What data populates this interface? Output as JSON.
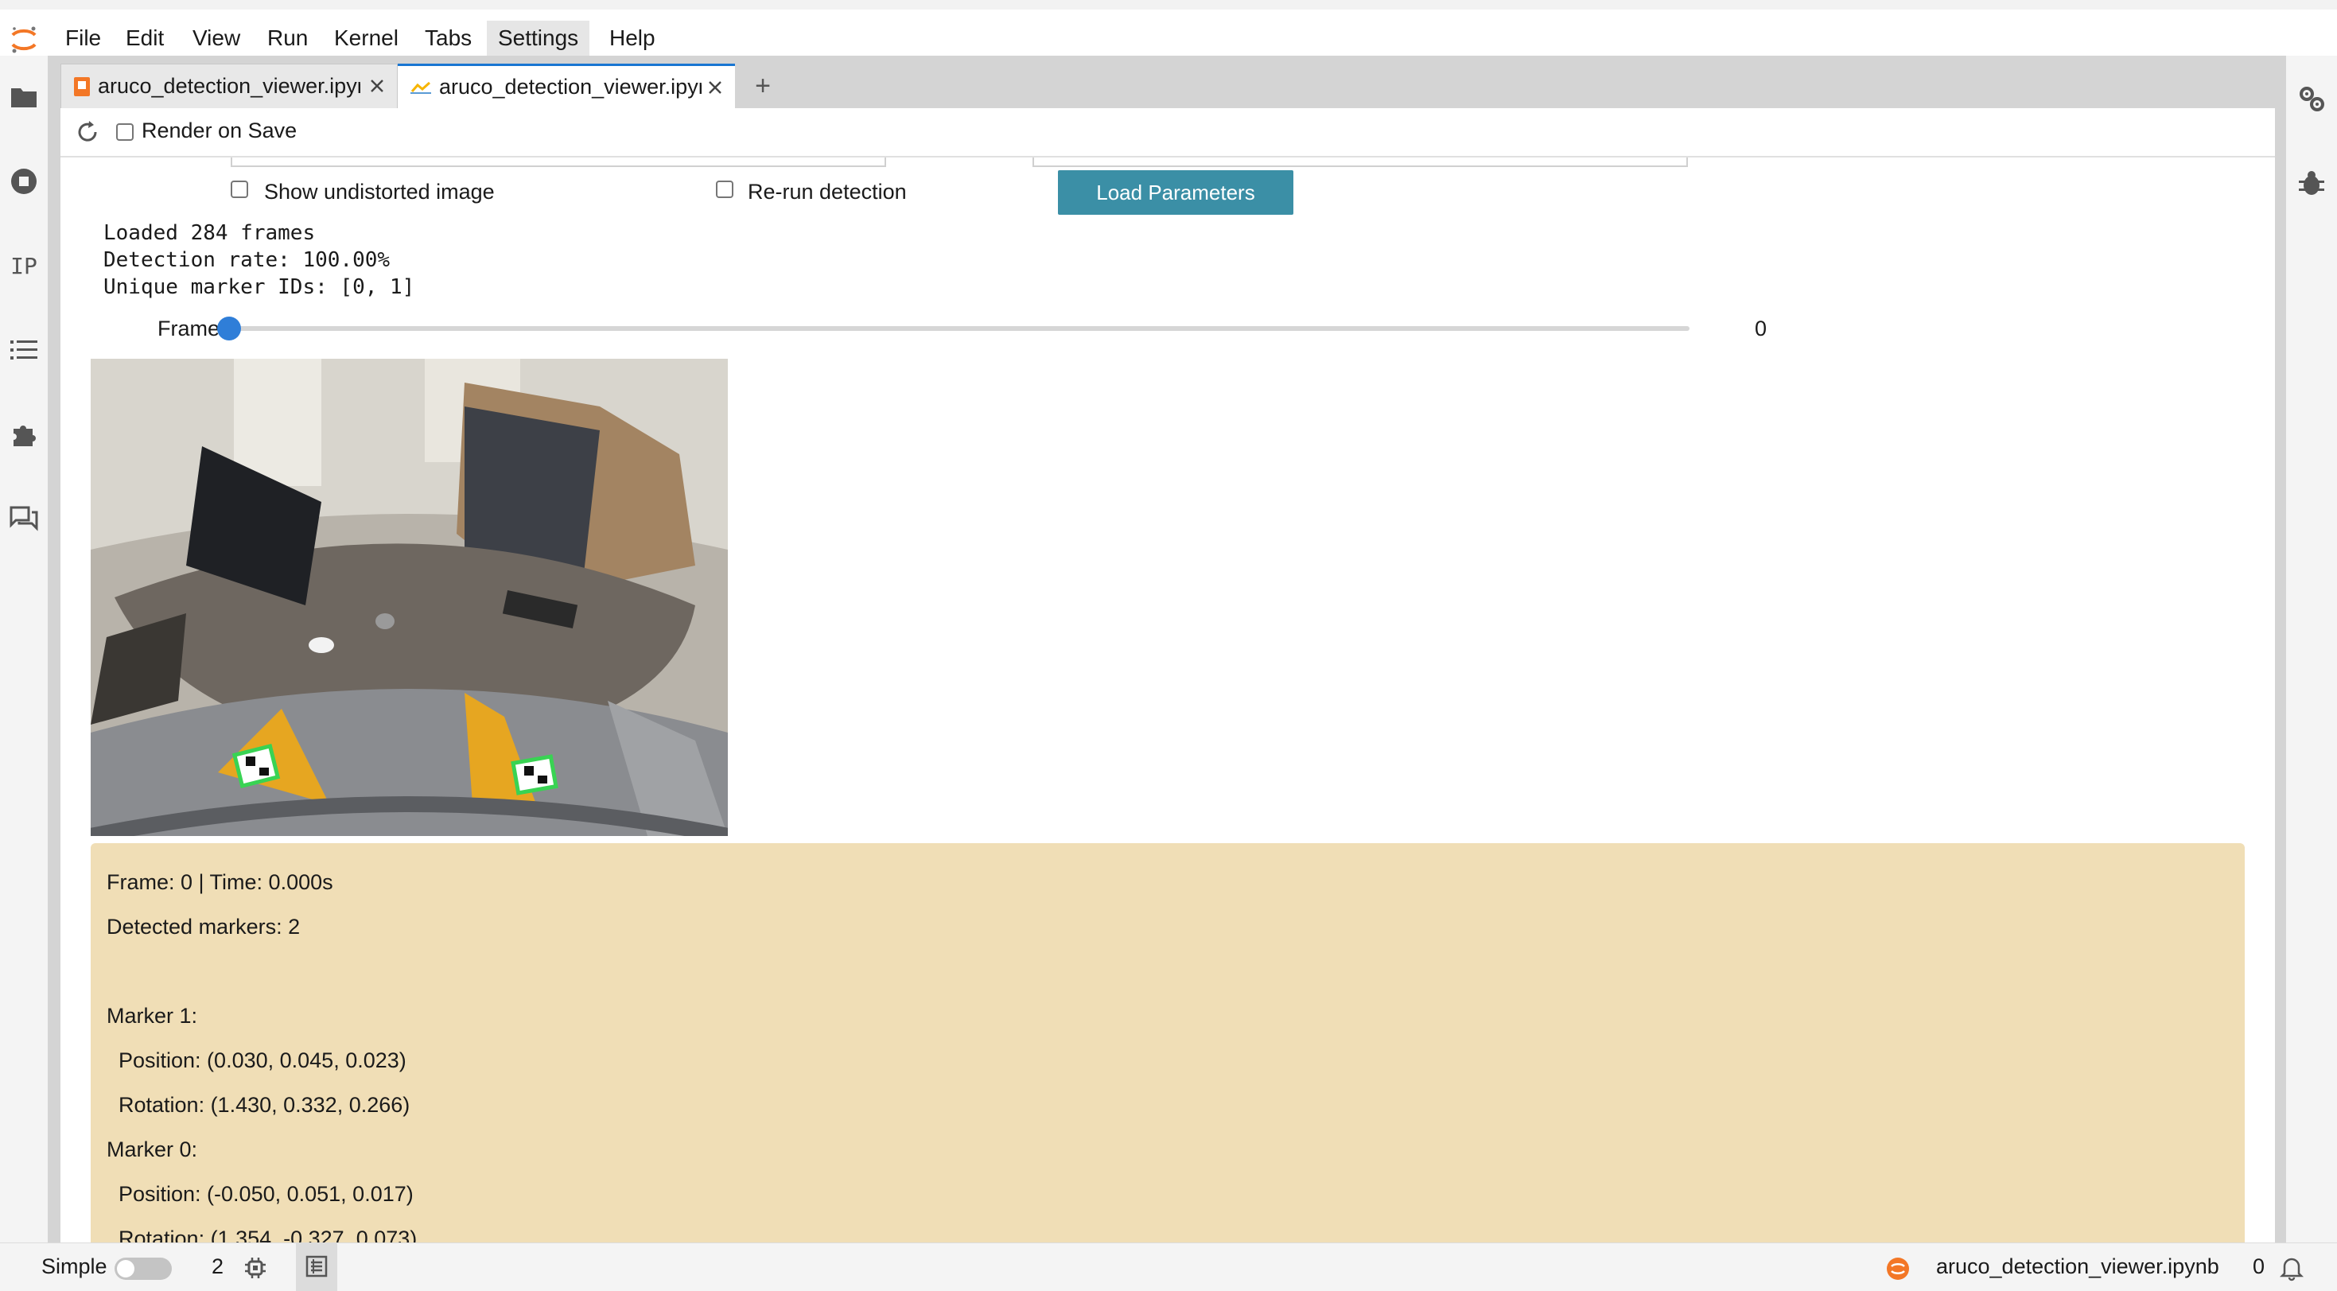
{
  "menu": [
    "File",
    "Edit",
    "View",
    "Run",
    "Kernel",
    "Tabs",
    "Settings",
    "Help"
  ],
  "tabs": [
    {
      "label": "aruco_detection_viewer.ipynb",
      "icon": "notebook-icon",
      "active": false
    },
    {
      "label": "aruco_detection_viewer.ipynb",
      "icon": "chart-line-icon",
      "active": true
    }
  ],
  "toolbar": {
    "render_on_save_label": "Render on Save",
    "render_on_save_checked": false
  },
  "controls": {
    "show_undistorted_label": "Show undistorted image",
    "rerun_detection_label": "Re-run detection",
    "load_parameters_label": "Load Parameters"
  },
  "stdout_lines": [
    "Loaded 284 frames",
    "Detection rate: 100.00%",
    "Unique marker IDs: [0, 1]"
  ],
  "slider": {
    "label": "Frame",
    "value": "0",
    "min": 0,
    "max": 283
  },
  "output": {
    "frame_line": "Frame: 0 | Time: 0.000s",
    "detected_line": "Detected markers: 2",
    "markers": [
      {
        "title": "Marker 1:",
        "position": "  Position: (0.030, 0.045, 0.023)",
        "rotation": "  Rotation: (1.430, 0.332, 0.266)"
      },
      {
        "title": "Marker 0:",
        "position": "  Position: (-0.050, 0.051, 0.017)",
        "rotation": "  Rotation: (1.354, -0.327, 0.073)"
      }
    ]
  },
  "statusbar": {
    "mode_label": "Simple",
    "kernel_count": "2",
    "filename": "aruco_detection_viewer.ipynb",
    "notifications": "0"
  },
  "colors": {
    "accent": "#1976d2",
    "button": "#3b8fa6",
    "output_bg": "#f0deb6",
    "jupyter_orange": "#f37726"
  },
  "left_sidebar_icons": [
    "folder-icon",
    "stop-circle-icon",
    "property-inspector-icon",
    "table-of-contents-icon",
    "extension-icon",
    "chat-icon"
  ],
  "right_sidebar_icons": [
    "property-gears-icon",
    "debugger-bug-icon"
  ]
}
